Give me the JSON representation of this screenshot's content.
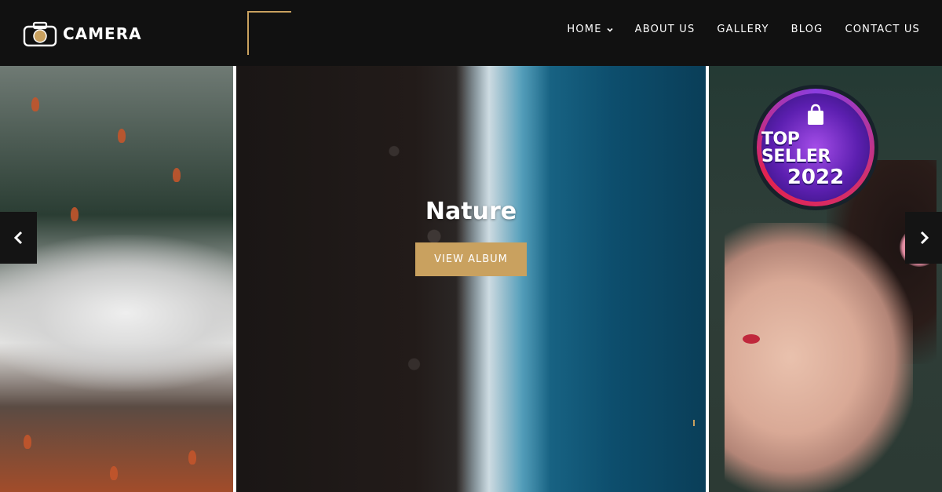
{
  "header": {
    "logo_text": "CAMERA",
    "nav": [
      {
        "label": "HOME",
        "has_dropdown": true
      },
      {
        "label": "ABOUT US"
      },
      {
        "label": "GALLERY"
      },
      {
        "label": "BLOG"
      },
      {
        "label": "CONTACT US"
      }
    ]
  },
  "slider": {
    "current_title": "Nature",
    "cta_label": "VIEW ALBUM",
    "prev_icon": "chevron-left-icon",
    "next_icon": "chevron-right-icon"
  },
  "badge": {
    "line1": "TOP SELLER",
    "line2": "2022"
  },
  "colors": {
    "header_bg": "#111111",
    "accent_gold": "#c9a15f",
    "arrow_bg": "#141414"
  }
}
